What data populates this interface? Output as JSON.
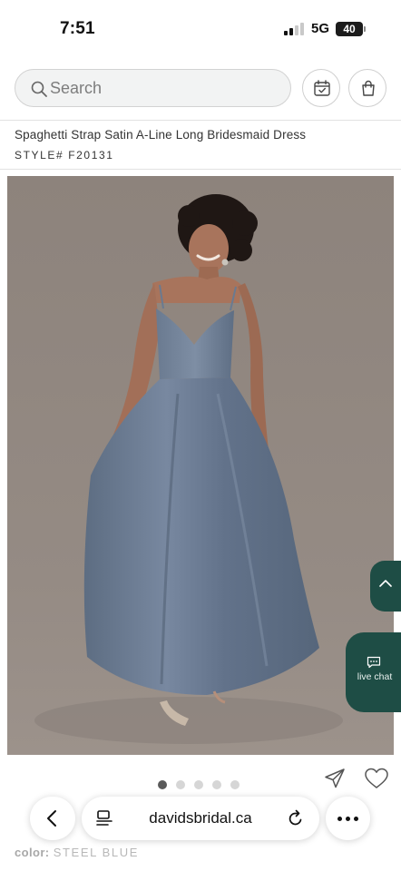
{
  "status_bar": {
    "time": "7:51",
    "network": "5G",
    "battery": "40"
  },
  "header": {
    "search_placeholder": "Search",
    "appointment_icon": "calendar-check-icon",
    "bag_icon": "shopping-bag-icon"
  },
  "product": {
    "title": "Spaghetti Strap Satin A-Line Long Bridesmaid Dress",
    "style": "STYLE# F20131",
    "image_alt": "Model wearing steel blue spaghetti strap satin A-line long bridesmaid dress",
    "image_count": 5,
    "active_image_index": 0,
    "color_label": "color:",
    "color_value": "STEEL BLUE",
    "dress_color": "#6f7f93",
    "backdrop_color": "#8f857e"
  },
  "widgets": {
    "live_chat_label": "live chat",
    "accent_color": "#1e4d45"
  },
  "browser": {
    "url": "davidsbridal.ca"
  }
}
